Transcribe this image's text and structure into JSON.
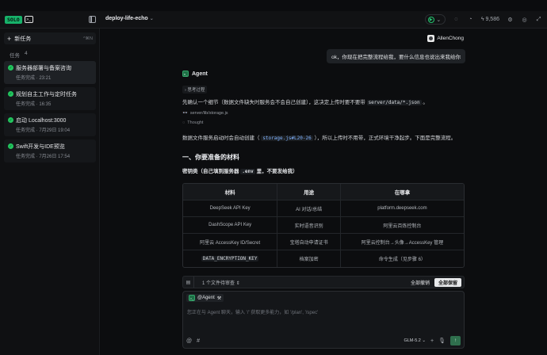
{
  "app": {
    "logo_text": "SOLO",
    "logo_icon": "terminal-icon",
    "project_title": "deploy-life-echo",
    "points": "9,586"
  },
  "sidebar": {
    "new_task_label": "新任务",
    "new_task_shortcut": "^⌘N",
    "tasks_label": "任务",
    "tasks_count": "4",
    "items": [
      {
        "name": "服务器部署与备案咨询",
        "meta": "任务完成 · 23:21",
        "active": true
      },
      {
        "name": "规划自主工作与定时任务",
        "meta": "任务完成 · 16:35",
        "active": false
      },
      {
        "name": "启动 Localhost:3000",
        "meta": "任务完成 · 7月29日 19:04",
        "active": false
      },
      {
        "name": "Swift开发与IDE预览",
        "meta": "任务完成 · 7月26日 17:54",
        "active": false
      }
    ]
  },
  "chat": {
    "user_name": "AllenChong",
    "user_message": "ok，你现在把完整流程给我，要什么信息也说出来我给你",
    "agent_name": "Agent",
    "think_chip": "思考过程",
    "para1_pre": "先确认一个细节（数据文件缺失时服务会不会自己创建），这决定上传时要不要带",
    "para1_code": "server/data/*.json",
    "para1_post": "。",
    "file_ref": "server/lib/storage.js",
    "thought_label": "Thought",
    "para2_pre": "数据文件服务启动时会自动创建（",
    "para2_code": "storage.js#L20-26",
    "para2_post": "），所以上传时不用带，正式环境干净起步。下面是完整流程。",
    "heading": "一、你要准备的材料",
    "subheading_pre": "密钥类（自己填到服务器",
    "subheading_code": ".env",
    "subheading_post": "里，不要发给我）",
    "table": {
      "headers": [
        "材料",
        "用途",
        "在哪拿"
      ],
      "rows": [
        [
          "DeepSeek API Key",
          "AI 对话/总结",
          "platform.deepseek.com"
        ],
        [
          "DashScope API Key",
          "实时语音识别",
          "阿里云百炼控制台"
        ],
        [
          "阿里云 AccessKey ID/Secret",
          "宝塔自动申请证书",
          "阿里云控制台→头像→AccessKey 管理"
        ],
        [
          "DATA_ENCRYPTION_KEY",
          "档案加密",
          "命令生成（见步骤 6）"
        ]
      ]
    }
  },
  "review_bar": {
    "pending": "1 个文件待审查",
    "reject_all": "全部撤销",
    "accept_all": "全部保留"
  },
  "composer": {
    "mention": "@Agent",
    "placeholder": "您正在与 Agent 聊天，输入 '/' 获取更多能力，如 '/plan', '/spec'",
    "model": "GLM-5.2"
  }
}
